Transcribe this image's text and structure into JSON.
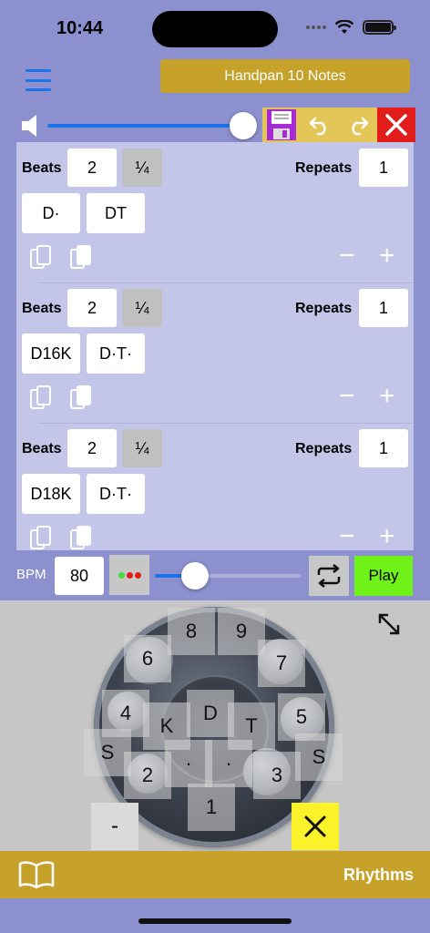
{
  "status": {
    "time": "10:44"
  },
  "header": {
    "title": "Handpan 10 Notes"
  },
  "volume": {
    "level_fraction": 0.95
  },
  "toolbar": {
    "icons": [
      "save-icon",
      "undo-icon",
      "redo-icon",
      "close-icon"
    ]
  },
  "sequence": {
    "beats_label": "Beats",
    "repeats_label": "Repeats",
    "fraction_label": "¼",
    "minus": "−",
    "plus": "+",
    "blocks": [
      {
        "beats": "2",
        "repeats": "1",
        "patterns": [
          "D·",
          "DT"
        ]
      },
      {
        "beats": "2",
        "repeats": "1",
        "patterns": [
          "D16K",
          "D·T·"
        ]
      },
      {
        "beats": "2",
        "repeats": "1",
        "patterns": [
          "D18K",
          "D·T·"
        ]
      }
    ]
  },
  "tempo": {
    "bpm_label": "BPM",
    "bpm_value": "80",
    "slider_fraction": 0.27,
    "play_label": "Play",
    "dot_colors": [
      "#3ee03e",
      "#e21b1b",
      "#e21b1b"
    ]
  },
  "handpan": {
    "keys": [
      "8",
      "9",
      "6",
      "7",
      "4",
      "D",
      "5",
      "K",
      "T",
      "S",
      "S",
      "2",
      "·",
      "·",
      "3",
      "1"
    ],
    "minus_label": "-"
  },
  "bottom": {
    "rhythms_label": "Rhythms"
  },
  "colors": {
    "accent": "#1a73e8",
    "gold": "#c6a22a",
    "play": "#6ef21a",
    "close": "#e21b1b",
    "background": "#8d90cf"
  }
}
